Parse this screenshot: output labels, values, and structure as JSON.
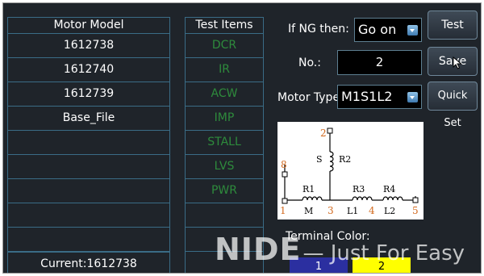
{
  "motor_table": {
    "header": "Motor Model",
    "rows": [
      "1612738",
      "1612740",
      "1612739",
      "Base_File",
      "",
      "",
      "",
      "",
      ""
    ],
    "current": "Current:1612738"
  },
  "test_table": {
    "header": "Test Items",
    "items": [
      "DCR",
      "IR",
      "ACW",
      "IMP",
      "STALL",
      "LVS",
      "PWR",
      "",
      "",
      ""
    ]
  },
  "ng": {
    "label": "If NG then:",
    "value": "Go on"
  },
  "number": {
    "label": "No.:",
    "value": "2"
  },
  "motor_type": {
    "label": "Motor Type:",
    "value": "M1S1L2"
  },
  "buttons": {
    "test": "Test",
    "save": "Save",
    "quick_set": "Quick Set"
  },
  "diagram": {
    "terminals": [
      "1",
      "2",
      "3",
      "4",
      "5",
      "8"
    ],
    "coils": [
      "R1",
      "R2",
      "R3",
      "R4"
    ],
    "coil_prefixes": [
      "M",
      "S",
      "L1",
      "L2"
    ]
  },
  "terminal_color": {
    "label": "Terminal Color:",
    "items": [
      {
        "label": "1",
        "color": "#2b2fa0",
        "text_color": "#ffffff"
      },
      {
        "label": "2",
        "color": "#ffff00",
        "text_color": "#000000"
      }
    ]
  },
  "watermark": {
    "brand": "NIDE",
    "tagline": "— Just For Easy"
  },
  "colors": {
    "background": "#1f242a",
    "grid": "#3a6c86",
    "item_green": "#2e8b3c",
    "terminal_orange": "#d2691e"
  }
}
